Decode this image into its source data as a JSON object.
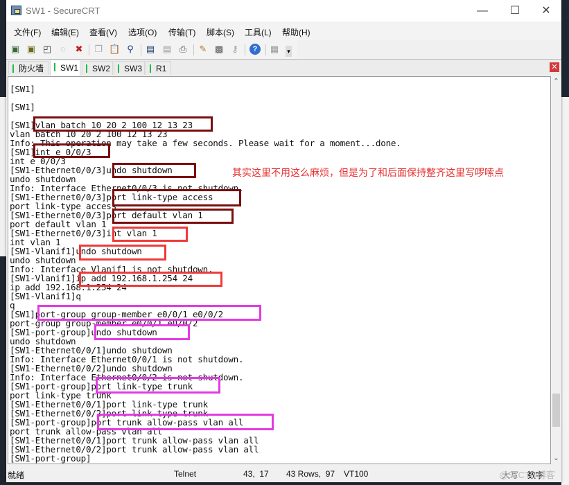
{
  "window": {
    "title": "SW1 - SecureCRT",
    "controls": {
      "minimize": "—",
      "maximize": "☐",
      "close": "✕"
    }
  },
  "menu": [
    "文件(F)",
    "编辑(E)",
    "查看(V)",
    "选项(O)",
    "传输(T)",
    "脚本(S)",
    "工具(L)",
    "帮助(H)"
  ],
  "toolbar": {
    "icons": [
      "connect-icon",
      "quick-connect-icon",
      "connect-tab-icon",
      "reconnect-icon",
      "disconnect-icon",
      "copy-icon",
      "paste-icon",
      "find-icon",
      "session-options-icon",
      "print-setup-icon",
      "print-icon",
      "global-options-icon",
      "keymap-icon",
      "key-icon",
      "help-icon",
      "window-icon",
      "overflow-icon"
    ]
  },
  "tabs": [
    {
      "label": "防火墙",
      "active": false,
      "status_color": "#22b845"
    },
    {
      "label": "SW1",
      "active": true,
      "status_color": "#22b845"
    },
    {
      "label": "SW2",
      "active": false,
      "status_color": "#22b845"
    },
    {
      "label": "SW3",
      "active": false,
      "status_color": "#22b845"
    },
    {
      "label": "R1",
      "active": false,
      "status_color": "#22b845"
    }
  ],
  "terminal": {
    "lines": [
      "[SW1]",
      "",
      "[SW1]",
      "",
      "[SW1]vlan batch 10 20 2 100 12 13 23",
      "vlan batch 10 20 2 100 12 13 23",
      "Info: This operation may take a few seconds. Please wait for a moment...done.",
      "[SW1]int e 0/0/3",
      "int e 0/0/3",
      "[SW1-Ethernet0/0/3]undo shutdown",
      "undo shutdown",
      "Info: Interface Ethernet0/0/3 is not shutdown.",
      "[SW1-Ethernet0/0/3]port link-type access",
      "port link-type access",
      "[SW1-Ethernet0/0/3]port default vlan 1",
      "port default vlan 1",
      "[SW1-Ethernet0/0/3]int vlan 1",
      "int vlan 1",
      "[SW1-Vlanif1]undo shutdown",
      "undo shutdown",
      "Info: Interface Vlanif1 is not shutdown.",
      "[SW1-Vlanif1]ip add 192.168.1.254 24",
      "ip add 192.168.1.254 24",
      "[SW1-Vlanif1]q",
      "q",
      "[SW1]port-group group-member e0/0/1 e0/0/2",
      "port-group group-member e0/0/1 e0/0/2",
      "[SW1-port-group]undo shutdown",
      "undo shutdown",
      "[SW1-Ethernet0/0/1]undo shutdown",
      "Info: Interface Ethernet0/0/1 is not shutdown.",
      "[SW1-Ethernet0/0/2]undo shutdown",
      "Info: Interface Ethernet0/0/2 is not shutdown.",
      "[SW1-port-group]port link-type trunk",
      "port link-type trunk",
      "[SW1-Ethernet0/0/1]port link-type trunk",
      "[SW1-Ethernet0/0/2]port link-type trunk",
      "[SW1-port-group]port trunk allow-pass vlan all",
      "port trunk allow-pass vlan all",
      "[SW1-Ethernet0/0/1]port trunk allow-pass vlan all",
      "[SW1-Ethernet0/0/2]port trunk allow-pass vlan all",
      "[SW1-port-group]"
    ],
    "annotation": "其实这里不用这么麻烦，但是为了和后面保持整齐这里写啰嗦点",
    "highlight_colors": {
      "dark_red": "#7a0d0d",
      "red": "#ee3a3a",
      "magenta": "#e23be2"
    }
  },
  "scrollbar": {
    "position_fraction": 0.92,
    "visible_fraction": 0.09
  },
  "status": {
    "state": "就绪",
    "protocol": "Telnet",
    "cursor": "43,  17",
    "size": "43 Rows,  97",
    "emulation": "VT100",
    "caps": "大写",
    "num": "数字"
  },
  "watermark": "@51CTO博客"
}
